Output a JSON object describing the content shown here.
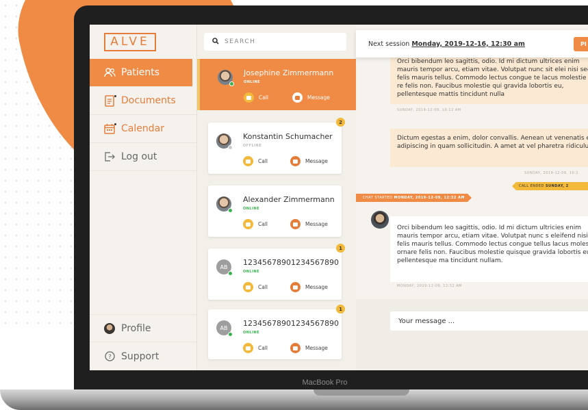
{
  "app": {
    "logo": "ALVE",
    "device_label": "MacBook Pro"
  },
  "sidebar": {
    "items": [
      {
        "label": "Patients",
        "icon": "users-icon"
      },
      {
        "label": "Documents",
        "icon": "document-icon"
      },
      {
        "label": "Calendar",
        "icon": "calendar-icon"
      },
      {
        "label": "Log out",
        "icon": "logout-icon"
      },
      {
        "label": "Profile",
        "icon": "avatar-icon"
      },
      {
        "label": "Support",
        "icon": "help-icon"
      }
    ]
  },
  "search": {
    "placeholder": "SEARCH"
  },
  "patients": [
    {
      "name": "Josephine Zimmermann",
      "status": "ONLINE",
      "call": "Call",
      "message": "Message",
      "badge": ""
    },
    {
      "name": "Konstantin Schumacher",
      "status": "OFFLINE",
      "call": "Call",
      "message": "Message",
      "badge": "2"
    },
    {
      "name": "Alexander Zimmermann",
      "status": "ONLINE",
      "call": "Call",
      "message": "Message",
      "badge": ""
    },
    {
      "name": "12345678901234567890",
      "status": "ONLINE",
      "call": "Call",
      "message": "Message",
      "badge": "1",
      "initials": "AB"
    },
    {
      "name": "12345678901234567890",
      "status": "ONLINE",
      "call": "Call",
      "message": "Message",
      "badge": "1",
      "initials": "AB"
    }
  ],
  "chat": {
    "session_prefix": "Next session",
    "session_date": "Monday, 2019-12-16, 12:30 am",
    "session_button": "PI",
    "messages": [
      {
        "text": "Orci bibendum leo sagittis, odio. Id mi dictum ultrices enim mauris tempor arcu, etiam vitae. Volutpat nunc sit elei nisi sed felis mauris tellus. Commodo lectus congue te lacus molestie orna re felis non. Faucibus molestie qui gravida lobortis eu, pellentesque mattis tincidunt nulla",
        "time": "SUNDAY, 2019-12-08, 10:12 AM"
      },
      {
        "text": "Dictum egestas a enim, dolor convallis. Aenean ut venenatis eu adipiscing in quam sollicitudin. A amet at vel pharetra ridiculus.",
        "time": "SUNDAY, 2019-12-08, 10:1"
      },
      {
        "text": "Orci bibendum leo sagittis, odio. Id mi dictum ultricies enim mauris tempor arcu, etiam vitae. Volutpat nunc s eleifend nisi sed felis mauris tellus. Commodo lectus congue tellus lacus molestie ornare felis non. Faucibus molestie quisque gravida lobortis eu, pellentesque ma tincidunt nullam.",
        "time": "MONDAY, 2019-12-09, 12:32 AM"
      }
    ],
    "call_ended_prefix": "CALL ENDED",
    "call_ended_date": "SUNDAY, 2",
    "chat_started_prefix": "CHAT STARTED",
    "chat_started_date": "MONDAY, 2019-12-09, 12:32 AM",
    "input_placeholder": "Your message ..."
  },
  "colors": {
    "accent": "#ef8b45",
    "accent_dark": "#e57d3a",
    "yellow": "#f2b93b",
    "online": "#34b24a"
  }
}
